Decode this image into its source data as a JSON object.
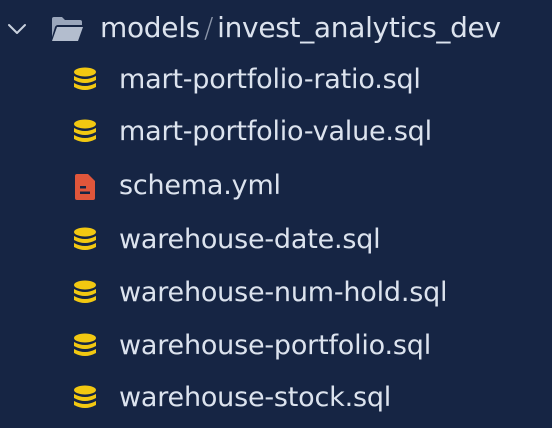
{
  "explorer": {
    "folder": {
      "name": "models",
      "separator": "/",
      "subfolder": "invest_analytics_dev",
      "icon": "folder-open-icon",
      "expanded": true
    },
    "files": [
      {
        "name": "mart-portfolio-ratio.sql",
        "icon": "database-icon"
      },
      {
        "name": "mart-portfolio-value.sql",
        "icon": "database-icon"
      },
      {
        "name": "schema.yml",
        "icon": "yaml-file-icon"
      },
      {
        "name": "warehouse-date.sql",
        "icon": "database-icon"
      },
      {
        "name": "warehouse-num-hold.sql",
        "icon": "database-icon"
      },
      {
        "name": "warehouse-portfolio.sql",
        "icon": "database-icon"
      },
      {
        "name": "warehouse-stock.sql",
        "icon": "database-icon"
      }
    ]
  },
  "colors": {
    "background": "#162544",
    "text": "#dce3ee",
    "database_icon": "#f2c811",
    "yaml_icon": "#e0563b",
    "folder_icon": "#9aa6bb"
  }
}
